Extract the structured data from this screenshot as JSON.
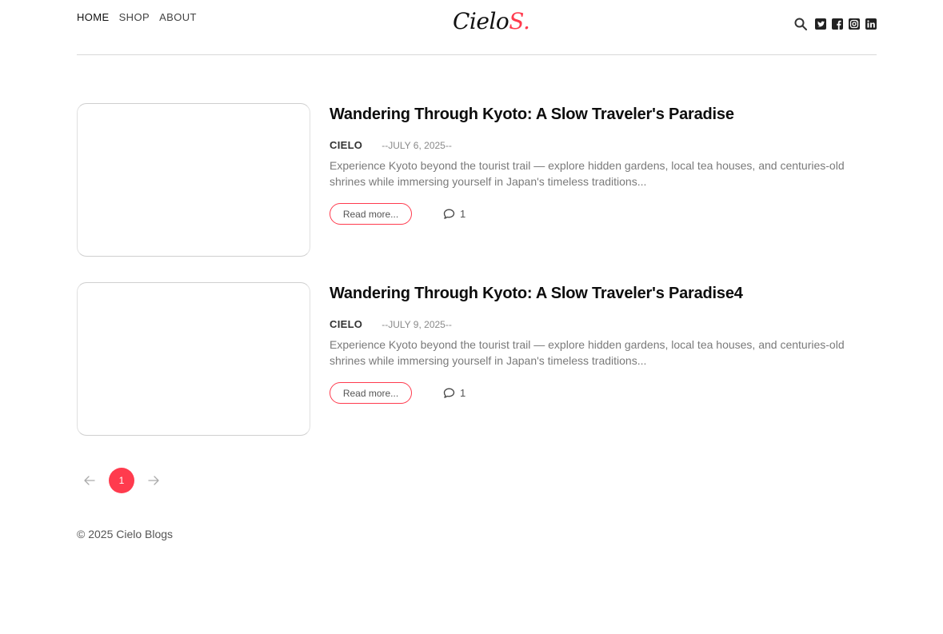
{
  "nav": {
    "items": [
      {
        "label": "HOME"
      },
      {
        "label": "SHOP"
      },
      {
        "label": "ABOUT"
      }
    ]
  },
  "logo": {
    "text": "Cielo",
    "accent": "S."
  },
  "icons": {
    "search": "search-icon",
    "social": [
      "twitter-icon",
      "facebook-icon",
      "instagram-icon",
      "linkedin-icon"
    ]
  },
  "colors": {
    "accent": "#ff3b4e",
    "text": "#0d0d0d",
    "muted": "#7a7a7a"
  },
  "posts": [
    {
      "title": "Wandering Through Kyoto: A Slow Traveler's Paradise",
      "author": "CIELO",
      "date": "--JULY 6, 2025--",
      "excerpt": "Experience Kyoto beyond the tourist trail — explore hidden gardens, local tea houses, and centuries-old shrines while immersing yourself in Japan's timeless traditions...",
      "read_more": "Read more...",
      "comments": "1"
    },
    {
      "title": "Wandering Through Kyoto: A Slow Traveler's Paradise4",
      "author": "CIELO",
      "date": "--JULY 9, 2025--",
      "excerpt": "Experience Kyoto beyond the tourist trail — explore hidden gardens, local tea houses, and centuries-old shrines while immersing yourself in Japan's timeless traditions...",
      "read_more": "Read more...",
      "comments": "1"
    }
  ],
  "pagination": {
    "prev": "←",
    "current": "1",
    "next": "→"
  },
  "footer": {
    "text": "© 2025 Cielo Blogs"
  }
}
